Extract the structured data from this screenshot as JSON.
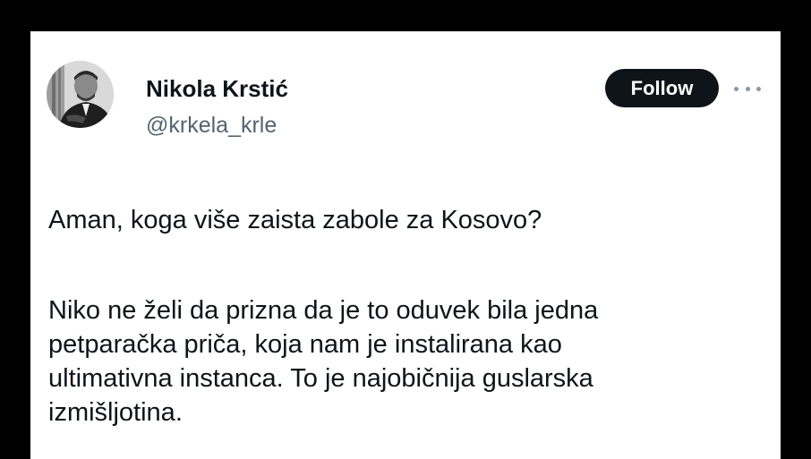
{
  "tweet": {
    "author": {
      "display_name": "Nikola Krstić",
      "handle": "@krkela_krle"
    },
    "follow_label": "Follow",
    "more_icon": "more-horizontal-icon",
    "paragraphs": [
      {
        "lines": [
          "Aman, koga više zaista zabole za Kosovo?"
        ]
      },
      {
        "lines": [
          "Niko ne želi da prizna da je to oduvek bila jedna",
          "petparačka priča, koja nam je instalirana kao",
          "ultimativna instanca. To je najobičnija guslarska",
          "izmišljotina."
        ]
      }
    ]
  },
  "colors": {
    "frame": "#000000",
    "card": "#ffffff",
    "text": "#0f1419",
    "handle": "#536471",
    "button_bg": "#0f1419",
    "button_text": "#ffffff"
  }
}
